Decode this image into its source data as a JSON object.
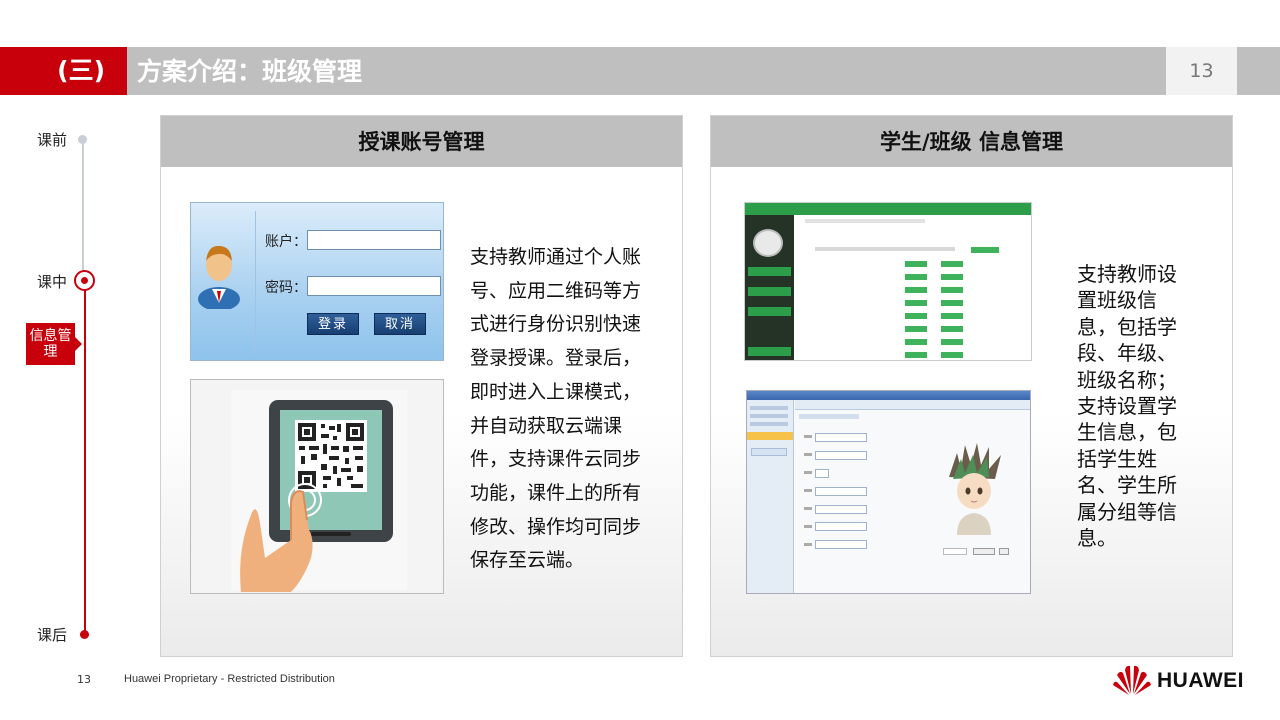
{
  "header": {
    "number": "(三)",
    "title": "方案介绍：班级管理",
    "page": "13"
  },
  "timeline": {
    "before": "课前",
    "during": "课中",
    "after": "课后",
    "tag": "信息管理"
  },
  "left_panel": {
    "title": "授课账号管理",
    "login": {
      "account_label": "账户：",
      "password_label": "密码：",
      "login_button": "登录",
      "cancel_button": "取消"
    },
    "description": "支持教师通过个人账号、应用二维码等方式进行身份识别快速登录授课。登录后，即时进入上课模式，并自动获取云端课件，支持课件云同步功能，课件上的所有修改、操作均可同步保存至云端。"
  },
  "right_panel": {
    "title": "学生/班级 信息管理",
    "description": "支持教师设置班级信息，包括学段、年级、班级名称；支持设置学生信息，包括学生姓名、学生所属分组等信息。"
  },
  "footer": {
    "page": "13",
    "text": "Huawei Proprietary - Restricted Distribution",
    "brand": "HUAWEI"
  },
  "colors": {
    "brand_red": "#c7000b",
    "header_gray": "#bfbfbf",
    "timeline_gray": "#c9cdd6"
  }
}
